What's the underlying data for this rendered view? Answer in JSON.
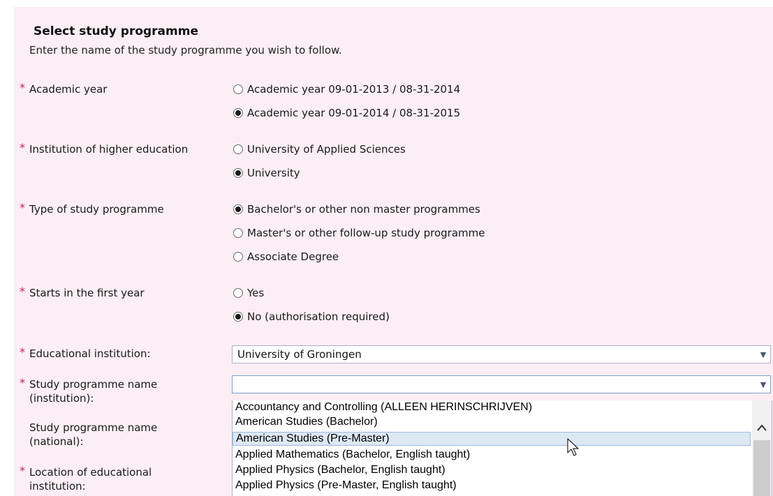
{
  "form": {
    "title": "Select study programme",
    "subtitle": "Enter the name of the study programme you wish to follow.",
    "required_mark": "*",
    "academic_year": {
      "label": "Academic year",
      "options": [
        "Academic year 09-01-2013 / 08-31-2014",
        "Academic year 09-01-2014 / 08-31-2015"
      ],
      "selected": 1
    },
    "institution_type": {
      "label": "Institution of higher education",
      "options": [
        "University of Applied Sciences",
        "University"
      ],
      "selected": 1
    },
    "programme_type": {
      "label": "Type of study programme",
      "options": [
        "Bachelor's or other non master programmes",
        "Master's or other follow-up study programme",
        "Associate Degree"
      ],
      "selected": 0
    },
    "first_year": {
      "label": "Starts in the first year",
      "options": [
        "Yes",
        "No (authorisation required)"
      ],
      "selected": 1
    },
    "educational_institution": {
      "label": "Educational institution:",
      "value": "University of Groningen"
    },
    "programme_name_institution": {
      "label_line1": "Study programme name",
      "label_line2": "(institution):",
      "value": ""
    },
    "programme_name_national": {
      "label_line1": "Study programme name",
      "label_line2": "(national):"
    },
    "location": {
      "label_line1": "Location of educational",
      "label_line2": "institution:"
    }
  },
  "dropdown": {
    "items": [
      "Accountancy and Controlling (ALLEEN HERINSCHRIJVEN)",
      "American Studies (Bachelor)",
      "American Studies (Pre-Master)",
      "Applied Mathematics (Bachelor, English taught)",
      "Applied Physics (Bachelor, English taught)",
      "Applied Physics (Pre-Master, English taught)"
    ],
    "highlighted_index": 2
  },
  "icons": {
    "dropdown_arrow": "chevron-down-icon",
    "scroll_up": "chevron-up-icon",
    "cursor": "mouse-pointer-icon"
  },
  "colors": {
    "panel_background": "#fbeef4",
    "required_mark": "#cc1e5a",
    "highlight": "#dde8f5"
  }
}
